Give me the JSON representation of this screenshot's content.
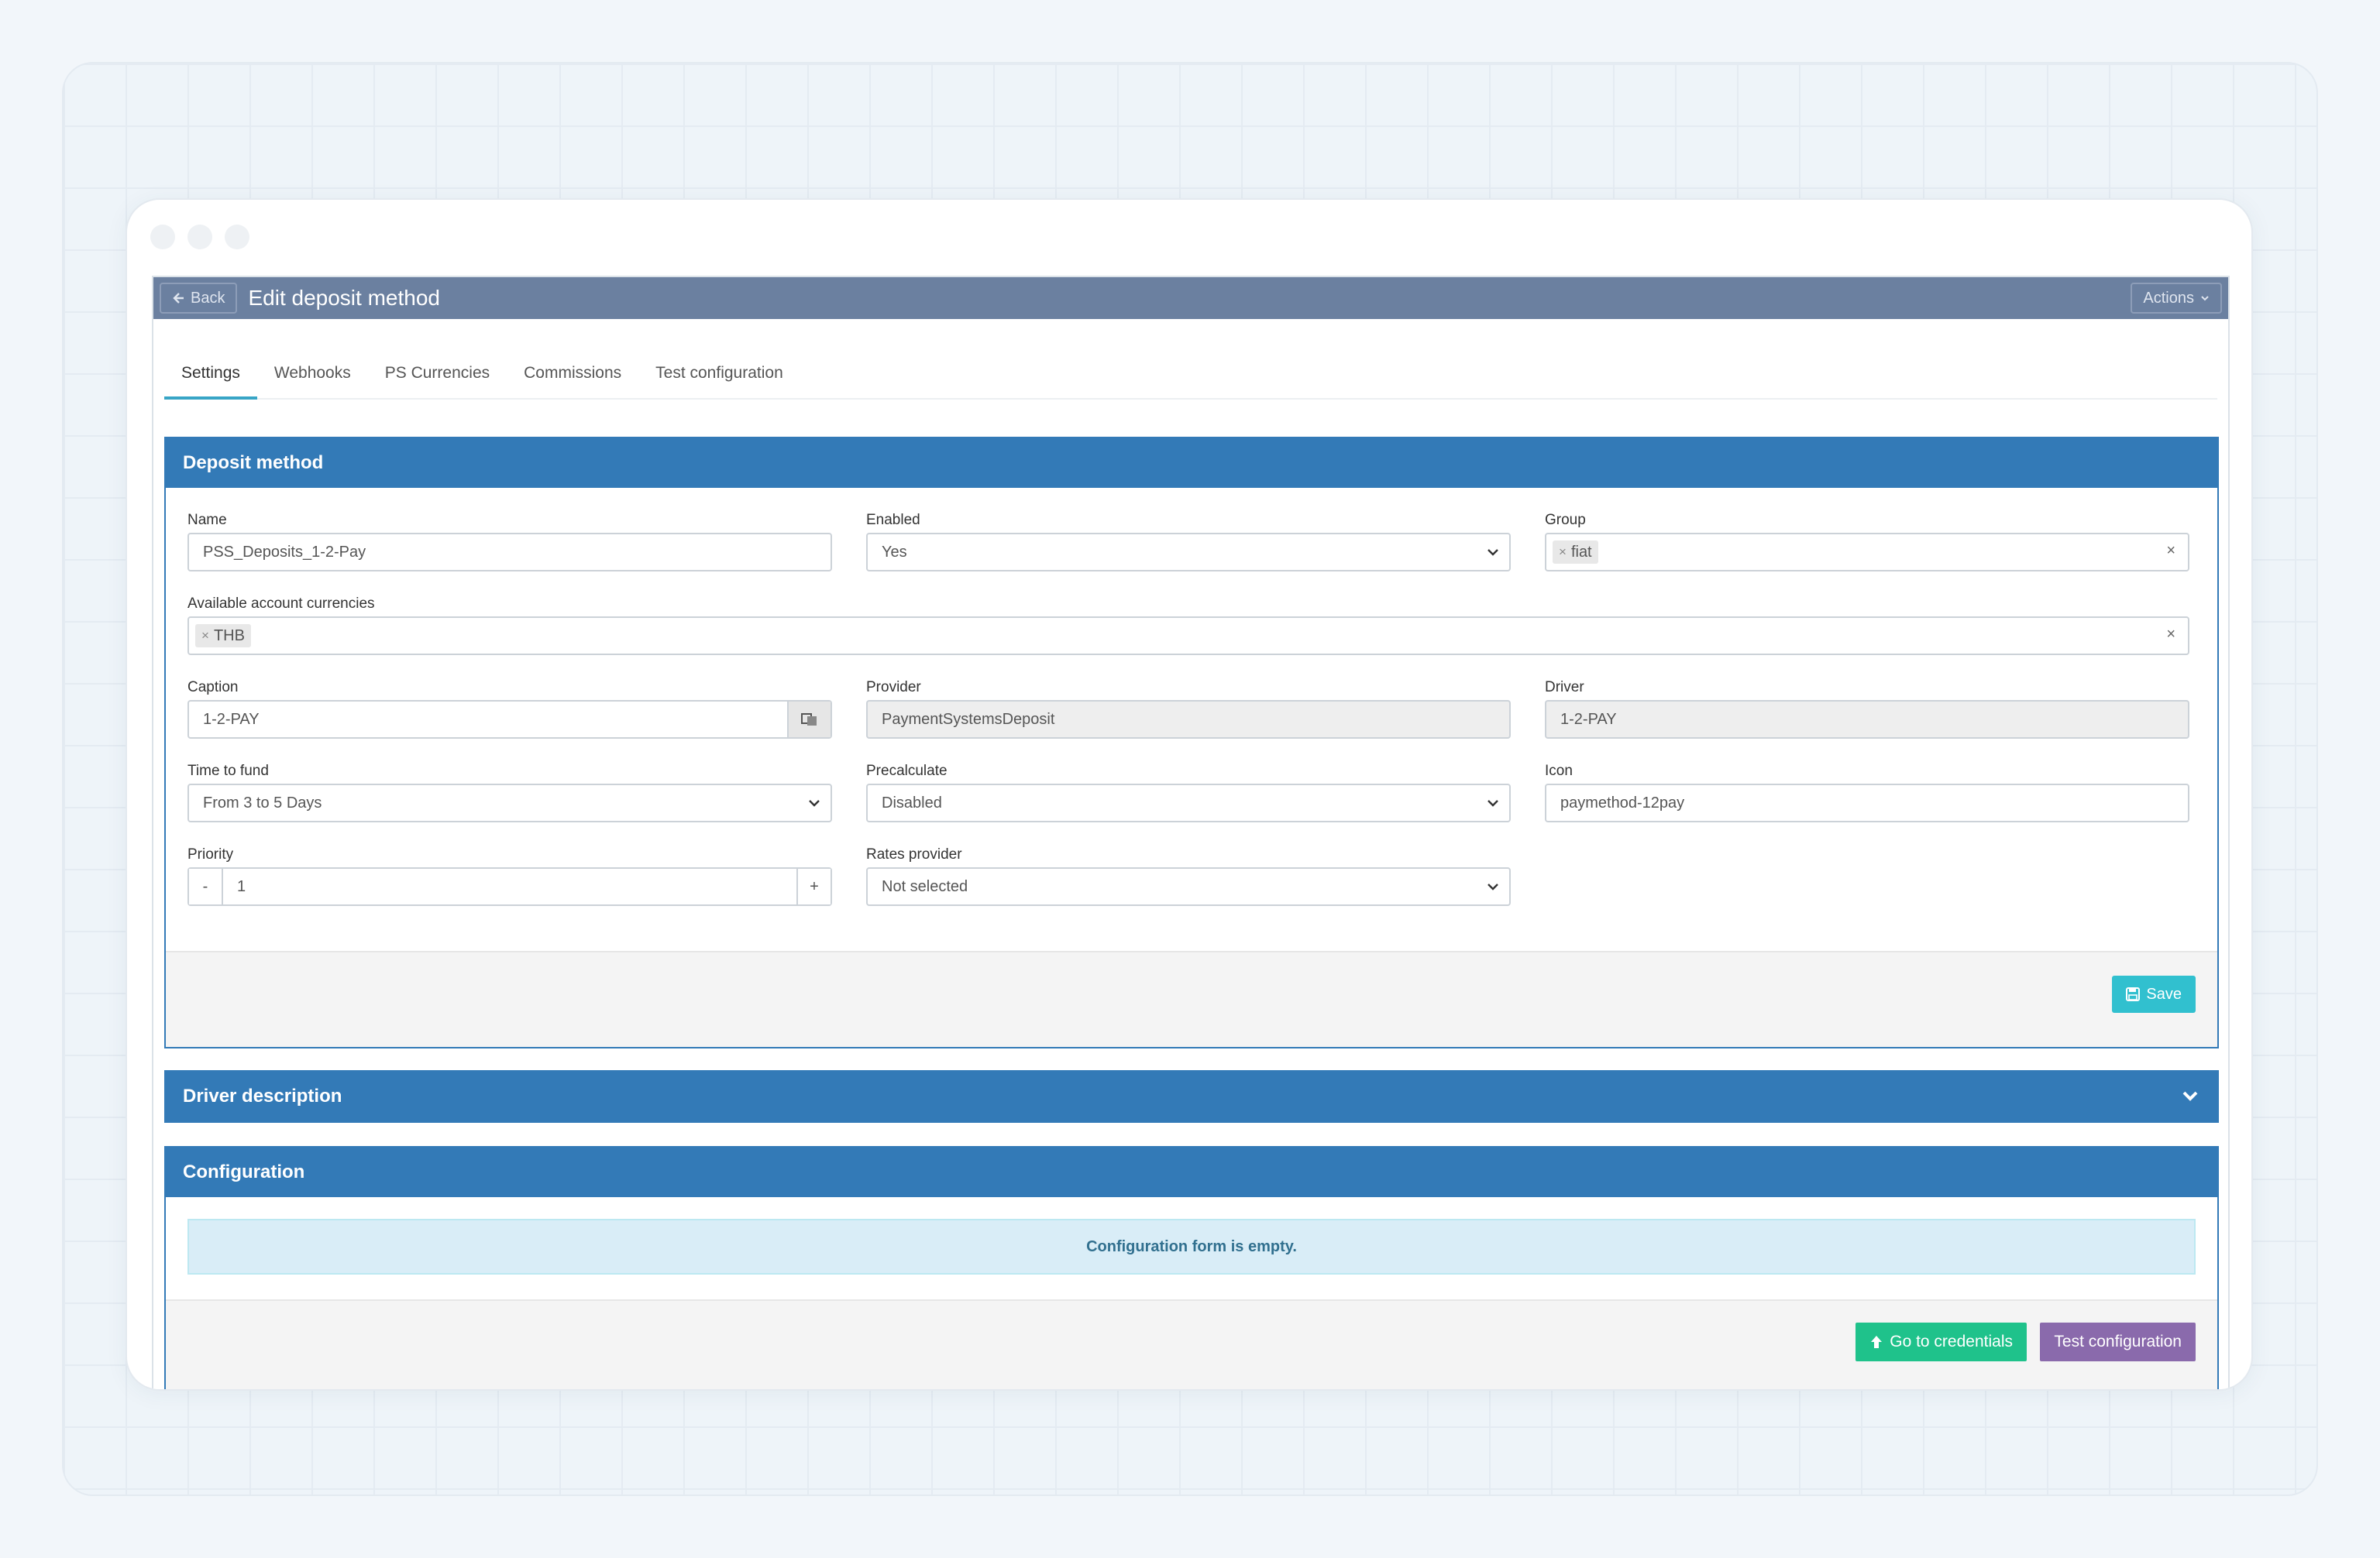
{
  "header": {
    "back_label": "Back",
    "title": "Edit deposit method",
    "actions_label": "Actions"
  },
  "tabs": [
    {
      "label": "Settings",
      "active": true
    },
    {
      "label": "Webhooks",
      "active": false
    },
    {
      "label": "PS Currencies",
      "active": false
    },
    {
      "label": "Commissions",
      "active": false
    },
    {
      "label": "Test configuration",
      "active": false
    }
  ],
  "deposit_method": {
    "title": "Deposit method",
    "name": {
      "label": "Name",
      "value": "PSS_Deposits_1-2-Pay"
    },
    "enabled": {
      "label": "Enabled",
      "value": "Yes"
    },
    "group": {
      "label": "Group",
      "tags": [
        "fiat"
      ]
    },
    "currencies": {
      "label": "Available account currencies",
      "tags": [
        "THB"
      ]
    },
    "caption": {
      "label": "Caption",
      "value": "1-2-PAY"
    },
    "provider": {
      "label": "Provider",
      "value": "PaymentSystemsDeposit"
    },
    "driver": {
      "label": "Driver",
      "value": "1-2-PAY"
    },
    "time_to_fund": {
      "label": "Time to fund",
      "value": "From 3 to 5 Days"
    },
    "precalculate": {
      "label": "Precalculate",
      "value": "Disabled"
    },
    "icon": {
      "label": "Icon",
      "value": "paymethod-12pay"
    },
    "priority": {
      "label": "Priority",
      "value": "1",
      "minus": "-",
      "plus": "+"
    },
    "rates_provider": {
      "label": "Rates provider",
      "value": "Not selected"
    },
    "save_label": "Save"
  },
  "driver_description": {
    "title": "Driver description"
  },
  "configuration": {
    "title": "Configuration",
    "empty_message": "Configuration form is empty.",
    "credentials_label": "Go to credentials",
    "test_label": "Test configuration"
  },
  "colors": {
    "topbar": "#6b80a0",
    "panel_primary": "#337ab7",
    "save_button": "#31c0cf",
    "credentials_button": "#1fc28b",
    "test_button": "#8a6aac",
    "tab_accent": "#38a5c6"
  }
}
